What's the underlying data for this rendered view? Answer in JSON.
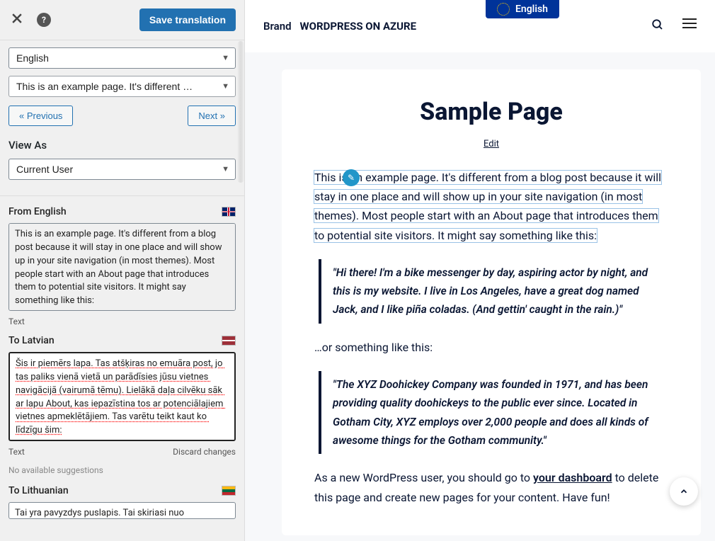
{
  "toolbar": {
    "save": "Save translation"
  },
  "top_selects": {
    "lang": "English",
    "string": "This is an example page. It's different …"
  },
  "nav": {
    "prev": "« Previous",
    "next": "Next »"
  },
  "viewAs": {
    "heading": "View As",
    "selected": "Current User"
  },
  "from": {
    "label": "From English",
    "text": "This is an example page. It's different from a blog post because it will stay in one place and will show up in your site navigation (in most themes). Most people start with an About page that introduces them to potential site visitors. It might say something like this:",
    "under": "Text"
  },
  "to_lv": {
    "label": "To Latvian",
    "text": "Šis ir piemērs lapa. Tas atšķiras no emuāra post, jo tas paliks vienā vietā un parādīsies jūsu vietnes navigācijā (vairumā tēmu). Lielākā daļa cilvēku sāk ar lapu About, kas iepazīstina tos ar potenciālajiem vietnes apmeklētājiem. Tas varētu teikt kaut ko līdzīgu šim:",
    "under": "Text",
    "discard": "Discard changes",
    "nosugg": "No available suggestions"
  },
  "to_lt": {
    "label": "To Lithuanian",
    "text": "Tai yra pavyzdys puslapis. Tai skiriasi nuo"
  },
  "preview": {
    "brand": "Brand",
    "site": "WORDPRESS ON AZURE",
    "langchip": "English",
    "title": "Sample Page",
    "edit": "Edit",
    "p1": "This is an example page. It's different from a blog post because it will stay in one place and will show up in your site navigation (in most themes). Most people start with an About page that introduces them to potential site visitors. It might say something like this:",
    "q1": "\"Hi there! I'm a bike messenger by day, aspiring actor by night, and this is my website. I live in Los Angeles, have a great dog named Jack, and I like piña coladas. (And gettin' caught in the rain.)\"",
    "p2": "…or something like this:",
    "q2": "\"The XYZ Doohickey Company was founded in 1971, and has been providing quality doohickeys to the public ever since. Located in Gotham City, XYZ employs over 2,000 people and does all kinds of awesome things for the Gotham community.\"",
    "p3a": "As a new WordPress user, you should go to ",
    "p3link": "your dashboard",
    "p3b": " to delete this page and create new pages for your content. Have fun!"
  }
}
